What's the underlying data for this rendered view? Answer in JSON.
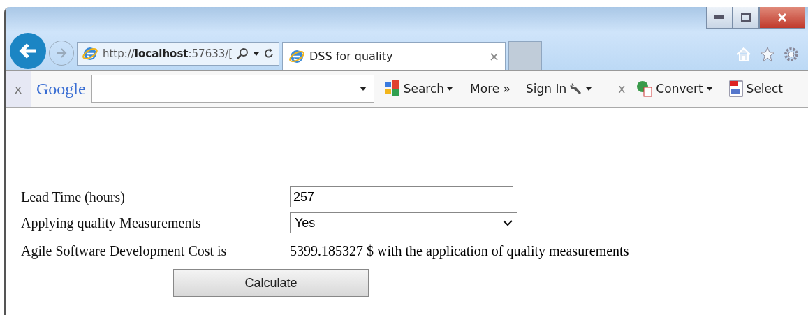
{
  "browser": {
    "address": {
      "prefix": "http://",
      "host": "localhost",
      "rest": ":57633/["
    },
    "tabs": [
      {
        "title": "DSS for quality",
        "close": "×",
        "selected": true
      }
    ],
    "toolbar": {
      "close": "x",
      "logo": "Google",
      "items": [
        {
          "kind": "google-search",
          "label": "Search"
        },
        {
          "kind": "more",
          "label": "More »"
        },
        {
          "kind": "sign-in",
          "label": "Sign In"
        },
        {
          "kind": "close",
          "label": "x"
        },
        {
          "kind": "convert",
          "label": "Convert"
        },
        {
          "kind": "select",
          "label": "Select"
        }
      ]
    }
  },
  "form": {
    "fields": [
      {
        "kind": "input",
        "label": "Lead Time (hours)",
        "value": "257"
      },
      {
        "kind": "select",
        "label": "Applying quality Measurements",
        "value": "Yes"
      },
      {
        "kind": "result",
        "label": "Agile Software Development Cost is",
        "value": "5399.185327 $ with the application of quality measurements"
      }
    ],
    "button": "Calculate"
  }
}
